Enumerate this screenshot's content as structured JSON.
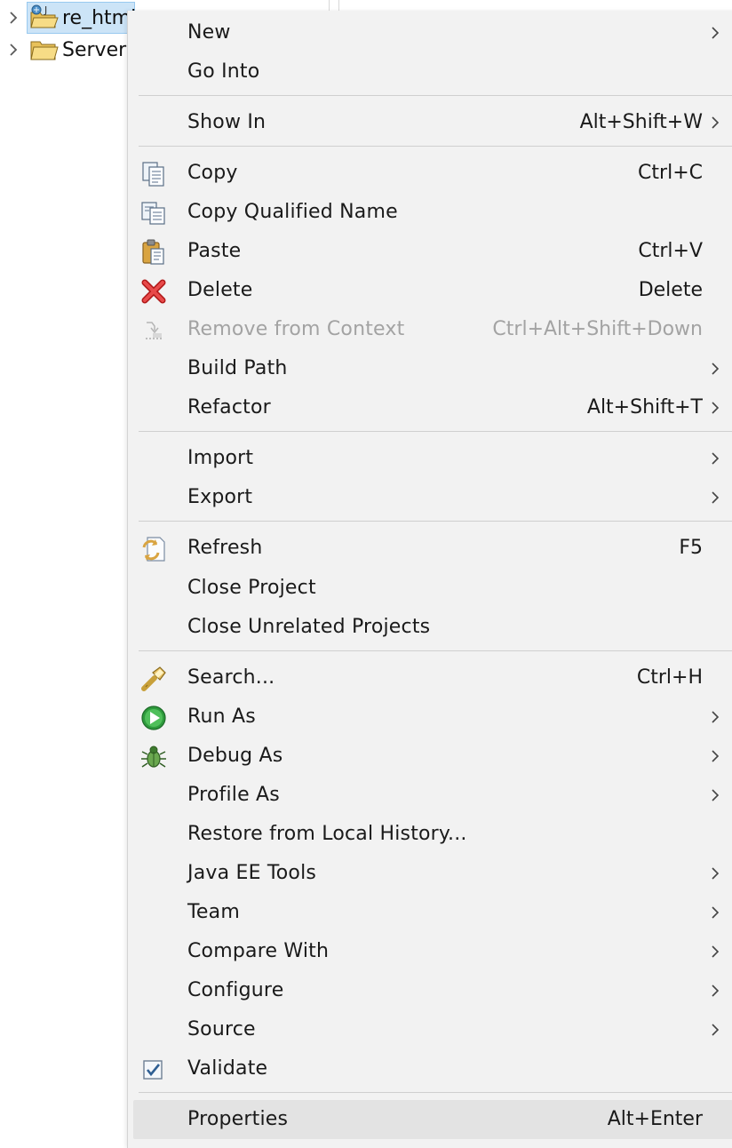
{
  "tree": {
    "items": [
      {
        "label": "re_html",
        "selected": true
      },
      {
        "label": "Servers",
        "selected": false
      }
    ]
  },
  "menu": {
    "groups": [
      [
        {
          "label": "New",
          "submenu": true
        },
        {
          "label": "Go Into"
        }
      ],
      [
        {
          "label": "Show In",
          "shortcut": "Alt+Shift+W",
          "submenu": true
        }
      ],
      [
        {
          "label": "Copy",
          "shortcut": "Ctrl+C",
          "icon": "copy-icon"
        },
        {
          "label": "Copy Qualified Name",
          "icon": "copy-qualified-name-icon"
        },
        {
          "label": "Paste",
          "shortcut": "Ctrl+V",
          "icon": "paste-icon"
        },
        {
          "label": "Delete",
          "shortcut": "Delete",
          "icon": "delete-icon"
        },
        {
          "label": "Remove from Context",
          "shortcut": "Ctrl+Alt+Shift+Down",
          "icon": "remove-from-context-icon",
          "disabled": true
        },
        {
          "label": "Build Path",
          "submenu": true
        },
        {
          "label": "Refactor",
          "shortcut": "Alt+Shift+T",
          "submenu": true
        }
      ],
      [
        {
          "label": "Import",
          "submenu": true
        },
        {
          "label": "Export",
          "submenu": true
        }
      ],
      [
        {
          "label": "Refresh",
          "shortcut": "F5",
          "icon": "refresh-icon"
        },
        {
          "label": "Close Project"
        },
        {
          "label": "Close Unrelated Projects"
        }
      ],
      [
        {
          "label": "Search...",
          "shortcut": "Ctrl+H",
          "icon": "search-flashlight-icon"
        },
        {
          "label": "Run As",
          "submenu": true,
          "icon": "run-icon"
        },
        {
          "label": "Debug As",
          "submenu": true,
          "icon": "debug-bug-icon"
        },
        {
          "label": "Profile As",
          "submenu": true
        },
        {
          "label": "Restore from Local History..."
        },
        {
          "label": "Java EE Tools",
          "submenu": true
        },
        {
          "label": "Team",
          "submenu": true
        },
        {
          "label": "Compare With",
          "submenu": true
        },
        {
          "label": "Configure",
          "submenu": true
        },
        {
          "label": "Source",
          "submenu": true
        },
        {
          "label": "Validate",
          "icon": "validate-check-icon"
        }
      ],
      [
        {
          "label": "Properties",
          "shortcut": "Alt+Enter",
          "hover": true
        }
      ]
    ]
  },
  "colors": {
    "menu_bg": "#f2f2f2",
    "hover_bg": "#e3e3e3",
    "disabled_text": "#a3a3a3",
    "selection_bg": "#cce4f7"
  }
}
